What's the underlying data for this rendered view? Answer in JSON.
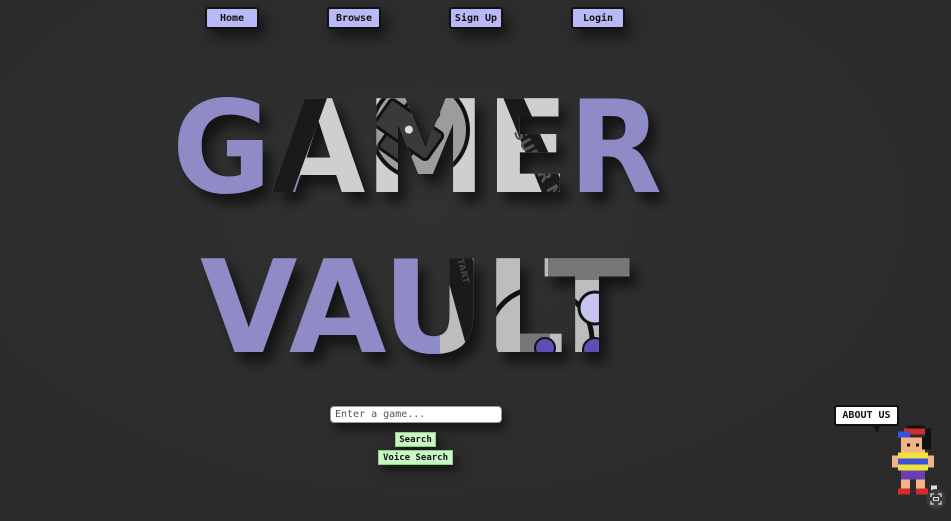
{
  "nav": {
    "items": [
      {
        "label": "Home"
      },
      {
        "label": "Browse"
      },
      {
        "label": "Sign Up"
      },
      {
        "label": "Login"
      }
    ]
  },
  "hero": {
    "line1": "GAMER",
    "line2": "VAULT",
    "text_color": "#8e8bc7",
    "controller_gray": "#cfcfcf",
    "controller_purple": "#5b4fb5",
    "controller_print_1": "SUPER NINT",
    "controller_print_2": "START"
  },
  "search": {
    "placeholder": "Enter a game...",
    "search_label": "Search",
    "voice_label": "Voice Search"
  },
  "about": {
    "label": "ABOUT US"
  },
  "colors": {
    "background": "#2b2b2b",
    "nav_button": "#b9b9f5",
    "action_button": "#c9f7c4"
  }
}
